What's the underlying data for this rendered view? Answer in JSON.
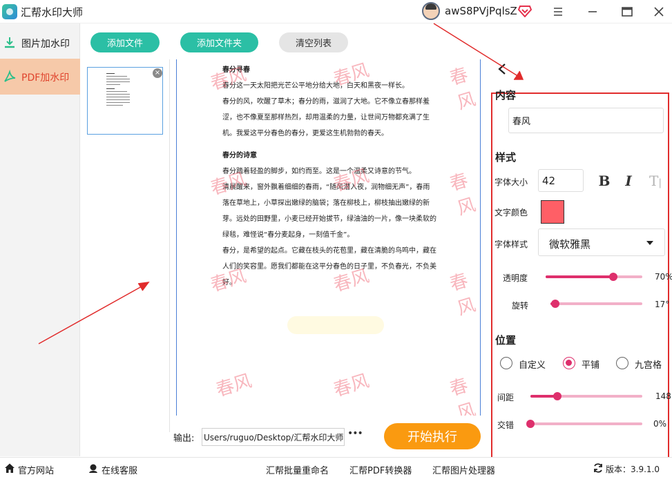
{
  "app": {
    "title": "汇帮水印大师"
  },
  "user": {
    "name": "awS8PVjPqlsZ"
  },
  "sidebar": {
    "items": [
      {
        "label": "图片加水印"
      },
      {
        "label": "PDF加水印"
      }
    ]
  },
  "toolbar": {
    "add_file": "添加文件",
    "add_folder": "添加文件夹",
    "clear_list": "清空列表"
  },
  "file_list": {
    "remove": "×"
  },
  "preview": {
    "heading1": "春分寻春",
    "p1": "春分这一天太阳把光芒公平地分给大地，白天和黑夜一样长。",
    "p2": "春分的风，吹醒了草木；春分的雨，滋润了大地。它不像立春那样羞涩，也不像夏至那样热烈，却用温柔的力量，让世间万物都充满了生机。我爱这平分春色的春分，更爱这生机勃勃的春天。",
    "heading2": "春分的诗意",
    "p3": "春分踏着轻盈的脚步，如约而至。这是一个温柔又诗意的节气。",
    "p4": "清晨醒来，窗外飘着细细的春雨，“随风潜入夜，润物细无声”，春雨落在草地上，小草探出嫩绿的脑袋；落在柳枝上，柳枝抽出嫩绿的新芽。远处的田野里，小麦已经开始拔节，绿油油的一片，像一块柔软的绿毯，难怪说“春分麦起身，一刻值千金”。",
    "p5": "春分，是希望的起点。它藏在枝头的花苞里，藏在清脆的鸟鸣中，藏在人们的笑容里。愿我们都能在这平分春色的日子里，不负春光，不负美好。",
    "watermark": "春风"
  },
  "output": {
    "label": "输出:",
    "path": "Users/ruguo/Desktop/汇帮水印大师",
    "more": "•••"
  },
  "start_button": "开始执行",
  "settings": {
    "content_title": "内容",
    "content_value": "春风",
    "style_title": "样式",
    "font_size_label": "字体大小",
    "font_size_value": "42",
    "bold": "B",
    "italic": "I",
    "vertical": "T",
    "text_color_label": "文字颜色",
    "text_color": "#ff5f66",
    "font_style_label": "字体样式",
    "font_family_value": "微软雅黑",
    "opacity_label": "透明度",
    "opacity_value": "70%",
    "opacity_fraction": 0.7,
    "rotation_label": "旋转",
    "rotation_value": "17°",
    "rotation_fraction": 0.05,
    "position_title": "位置",
    "position_options": [
      "自定义",
      "平铺",
      "九宫格"
    ],
    "position_selected": "平铺",
    "spacing_label": "间距",
    "spacing_value": "148",
    "spacing_fraction": 0.24,
    "stagger_label": "交错",
    "stagger_value": "0%",
    "stagger_fraction": 0.0
  },
  "bottom": {
    "official_site": "官方网站",
    "online_service": "在线客服",
    "batch_rename": "汇帮批量重命名",
    "pdf_converter": "汇帮PDF转换器",
    "image_processor": "汇帮图片处理器",
    "version_label": "版本：3.9.1.0"
  },
  "colors": {
    "accent_teal": "#2bbfa5",
    "accent_orange": "#fa9a10",
    "slider_pink": "#de2f6c",
    "annotation_red": "#e12c2c",
    "active_side": "#f6c9a9"
  }
}
